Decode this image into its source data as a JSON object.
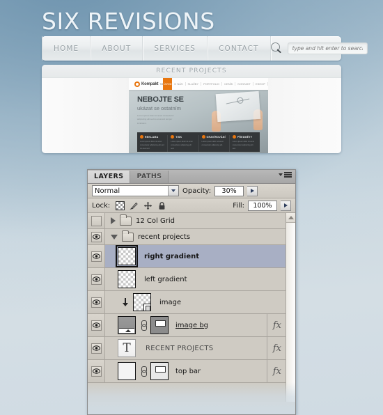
{
  "site": {
    "title": "SIX REVISIONS",
    "nav": [
      {
        "label": "HOME"
      },
      {
        "label": "ABOUT"
      },
      {
        "label": "SERVICES"
      },
      {
        "label": "CONTACT"
      }
    ],
    "search": {
      "icon": "search-icon",
      "placeholder": "type and hit enter to search",
      "value": ""
    },
    "projects": {
      "header": "RECENT PROJECTS",
      "mockup": {
        "logo": "Kompakt",
        "logo_tm": "TM",
        "active_tab": "ÚVOD",
        "tabs": [
          "O NÁS",
          "SLUŽBY",
          "PORTFOLIO",
          "CENÍK",
          "KONTAKT",
          "ESHOP"
        ],
        "headline": "NEBOJTE SE",
        "subhead": "ukázat se ostatním",
        "paragraph": "Lorem ipsum dolor sit amet consectetur adipiscing elit sed do eiusmod tempor incididunt.",
        "cards": [
          {
            "title": "REKLAMA",
            "text": "Lorem ipsum dolor sit amet consectetur adipiscing elit sed do eiusmod."
          },
          {
            "title": "TISK",
            "text": "Lorem ipsum dolor sit amet consectetur adipiscing elit sed."
          },
          {
            "title": "GRAVÍROVÁNÍ",
            "text": "Lorem ipsum dolor sit amet consectetur adipiscing elit."
          },
          {
            "title": "PŘEDMĚTY",
            "text": "Lorem ipsum dolor sit amet consectetur adipiscing elit sed."
          }
        ]
      }
    }
  },
  "panel": {
    "tabs": [
      {
        "label": "LAYERS",
        "active": true
      },
      {
        "label": "PATHS",
        "active": false
      }
    ],
    "menu_icon": "panel-menu-icon",
    "blend_mode": "Normal",
    "opacity_label": "Opacity:",
    "opacity_value": "30%",
    "lock_label": "Lock:",
    "lock_icons": [
      "lock-transparency-icon",
      "lock-image-pixels-icon",
      "lock-position-icon",
      "lock-all-icon"
    ],
    "fill_label": "Fill:",
    "fill_value": "100%",
    "layers": [
      {
        "name": "12 Col Grid",
        "kind": "group",
        "visible": false,
        "expanded": false,
        "selected": false,
        "indent": 0
      },
      {
        "name": "recent projects",
        "kind": "group",
        "visible": true,
        "expanded": true,
        "selected": false,
        "indent": 0
      },
      {
        "name": "right gradient",
        "kind": "pixel",
        "visible": true,
        "selected": true,
        "indent": 1
      },
      {
        "name": "left gradient",
        "kind": "pixel",
        "visible": true,
        "selected": false,
        "indent": 1
      },
      {
        "name": "image",
        "kind": "smart-object-clipped",
        "visible": true,
        "selected": false,
        "indent": 1,
        "clipped": true
      },
      {
        "name": "image bg",
        "kind": "masked",
        "visible": true,
        "selected": false,
        "indent": 1,
        "has_fx": true,
        "editing": true
      },
      {
        "name": "RECENT PROJECTS",
        "kind": "type",
        "visible": true,
        "selected": false,
        "indent": 1,
        "has_fx": true
      },
      {
        "name": "top bar",
        "kind": "masked",
        "visible": true,
        "selected": false,
        "indent": 1,
        "has_fx": true,
        "faded": true
      }
    ],
    "scrollbar": "vertical-scrollbar"
  },
  "colors": {
    "bg_top": "#8fadc2",
    "bg_bottom": "#d4dee4",
    "accent_orange": "#e8760f",
    "panel_bg": "#d4d0c8",
    "layer_selected": "#a8afc4"
  }
}
